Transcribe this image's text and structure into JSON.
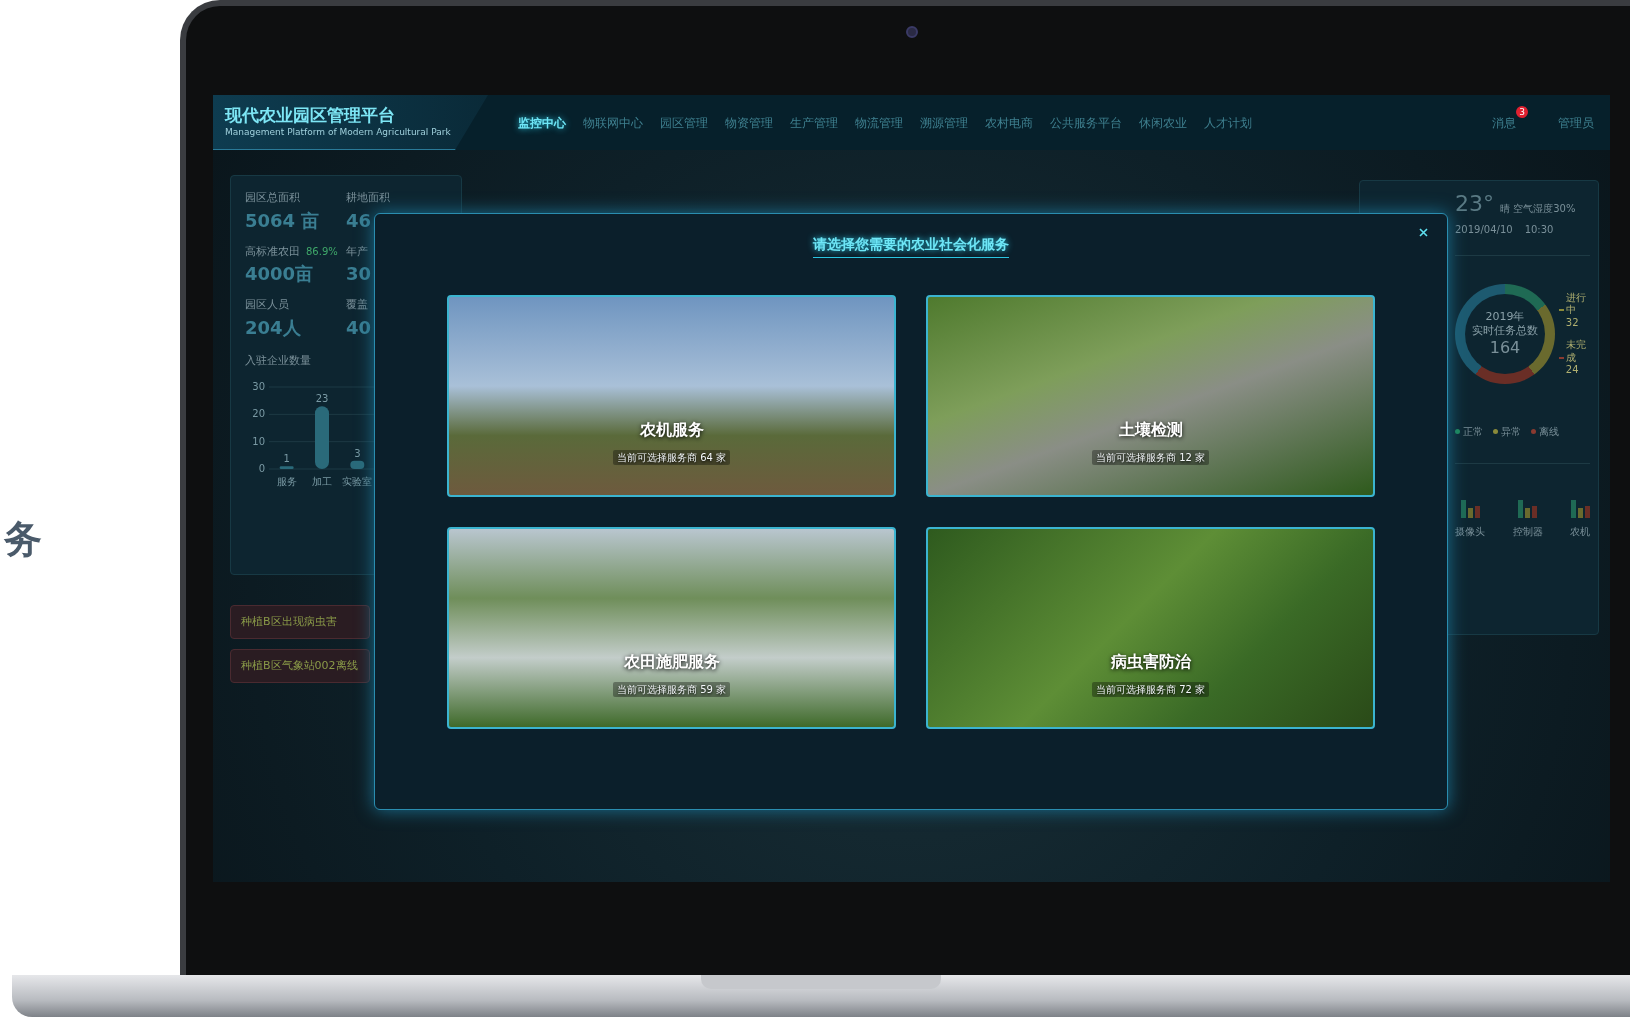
{
  "side_caption": "务",
  "header": {
    "title": "现代农业园区管理平台",
    "subtitle": "Management Platform of Modern Agricultural Park",
    "nav": [
      {
        "label": "监控中心",
        "selected": true
      },
      {
        "label": "物联网中心",
        "selected": false
      },
      {
        "label": "园区管理",
        "selected": false
      },
      {
        "label": "物资管理",
        "selected": false
      },
      {
        "label": "生产管理",
        "selected": false
      },
      {
        "label": "物流管理",
        "selected": false
      },
      {
        "label": "溯源管理",
        "selected": false
      },
      {
        "label": "农村电商",
        "selected": false
      },
      {
        "label": "公共服务平台",
        "selected": false
      },
      {
        "label": "休闲农业",
        "selected": false
      },
      {
        "label": "人才计划",
        "selected": false
      }
    ],
    "messages": {
      "label": "消息",
      "badge": "3"
    },
    "user": "管理员"
  },
  "left_panel": {
    "stats": [
      {
        "label": "园区总面积",
        "value": "5064 亩"
      },
      {
        "label": "耕地面积",
        "value": "46"
      },
      {
        "label": "高标准农田",
        "note": "86.9%",
        "value": "4000亩"
      },
      {
        "label": "年产",
        "value": "30"
      },
      {
        "label": "园区人员",
        "value": "204人"
      },
      {
        "label": "覆盖",
        "value": "40"
      }
    ],
    "chart_title": "入驻企业数量",
    "chart_data": {
      "type": "bar",
      "categories": [
        "服务",
        "加工",
        "实验室"
      ],
      "values": [
        1,
        23,
        3
      ],
      "ylim": [
        0,
        30
      ],
      "yticks": [
        0,
        10,
        20,
        30
      ],
      "data_labels": true
    }
  },
  "alerts": [
    "种植B区出现病虫害",
    "种植B区气象站002离线"
  ],
  "right_panel": {
    "temperature": "23°",
    "weather": "晴 空气湿度30%",
    "date": "2019/04/10",
    "time": "10:30",
    "donut": {
      "year": "2019年",
      "caption": "实时任务总数",
      "total": "164",
      "labels": [
        {
          "name": "进行中",
          "value": "32",
          "color": "#8a8a3a"
        },
        {
          "name": "未完成",
          "value": "24",
          "color": "#8a3a30"
        }
      ]
    },
    "legend": [
      {
        "label": "正常",
        "color": "#1f8a5a"
      },
      {
        "label": "异常",
        "color": "#8a8a3a"
      },
      {
        "label": "离线",
        "color": "#8a3a30"
      }
    ],
    "device_labels": [
      "摄像头",
      "控制器",
      "农机"
    ]
  },
  "modal": {
    "title": "请选择您需要的农业社会化服务",
    "services": [
      {
        "name": "农机服务",
        "providers": "当前可选择服务商 64 家"
      },
      {
        "name": "土壤检测",
        "providers": "当前可选择服务商 12 家"
      },
      {
        "name": "农田施肥服务",
        "providers": "当前可选择服务商 59 家"
      },
      {
        "name": "病虫害防治",
        "providers": "当前可选择服务商 72 家"
      }
    ]
  }
}
